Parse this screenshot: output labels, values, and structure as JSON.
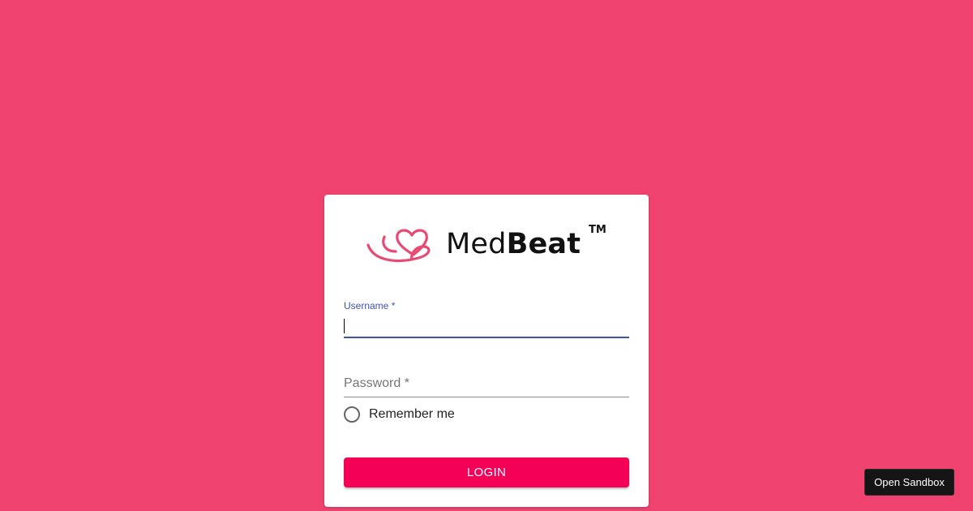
{
  "theme": {
    "background": "#ef426f",
    "card": "#ffffff",
    "primary": "#3f51b5",
    "button": "#f50057",
    "logo_heart": "#e94a74"
  },
  "logo": {
    "icon": "heart-ribbon-icon",
    "name_light": "Med",
    "name_bold": "Beat",
    "trademark": "TM"
  },
  "form": {
    "username": {
      "label": "Username *",
      "value": "",
      "focused": true
    },
    "password": {
      "label": "Password *",
      "value": ""
    },
    "remember": {
      "label": "Remember me",
      "checked": false
    },
    "login_label": "LOGIN"
  },
  "sandbox_button": {
    "label": "Open Sandbox"
  }
}
